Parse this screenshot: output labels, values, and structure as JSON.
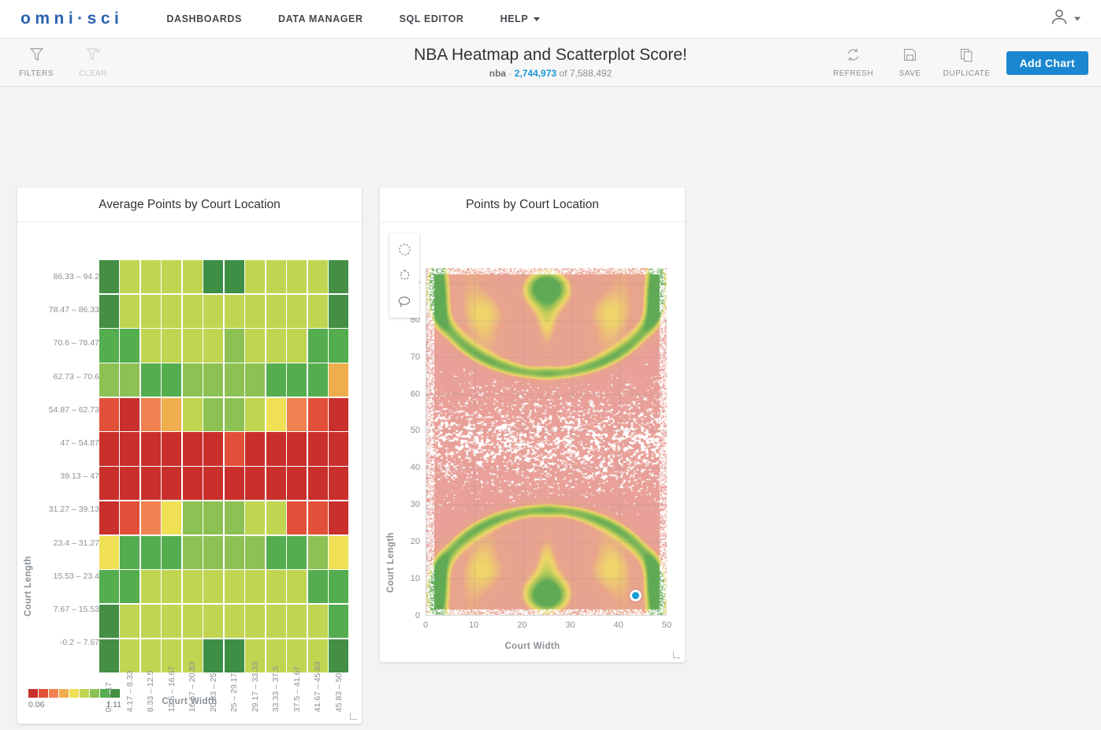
{
  "nav": {
    "brand": "omni·sci",
    "links": [
      {
        "label": "DASHBOARDS",
        "caret": false
      },
      {
        "label": "DATA MANAGER",
        "caret": false
      },
      {
        "label": "SQL EDITOR",
        "caret": false
      },
      {
        "label": "HELP",
        "caret": true
      }
    ],
    "user_icon": "user-avatar-icon"
  },
  "toolbar": {
    "filters_label": "FILTERS",
    "clear_label": "CLEAR",
    "refresh_label": "REFRESH",
    "save_label": "SAVE",
    "duplicate_label": "DUPLICATE",
    "add_chart_label": "Add Chart",
    "title": "NBA Heatmap and Scatterplot Score!",
    "subtitle_db": "nba",
    "subtitle_sep": "·",
    "subtitle_count": "2,744,973",
    "subtitle_of": "of 7,588,492",
    "accent_color": "#1a87d0",
    "count_color": "#1a9ad6"
  },
  "charts": {
    "heatmap": {
      "title": "Average Points by Court Location",
      "xlabel": "Court Width",
      "ylabel": "Court Length",
      "legend_min": "0.06",
      "legend_max": "1.11",
      "legend_colors": [
        "#c9302c",
        "#e2503a",
        "#ef8250",
        "#eeae4d",
        "#efe055",
        "#c1d552",
        "#8dc154",
        "#54ad4f",
        "#458f45"
      ]
    },
    "scatter": {
      "title": "Points by Court Location",
      "xlabel": "Court Width",
      "ylabel": "Court Length",
      "tools": [
        "circle-select-icon",
        "polygon-select-icon",
        "lasso-select-icon"
      ],
      "cursor": {
        "x": 43.5,
        "y": 5.6
      }
    }
  },
  "chart_data": [
    {
      "type": "heatmap",
      "title": "Average Points by Court Location",
      "xlabel": "Court Width",
      "ylabel": "Court Length",
      "legend": {
        "min": 0.06,
        "max": 1.11,
        "steps": 9
      },
      "x_categories": [
        "0 – 4.17",
        "4.17 – 8.33",
        "8.33 – 12.5",
        "12.5 – 16.67",
        "16.67 – 20.83",
        "20.83 – 25",
        "25 – 29.17",
        "29.17 – 33.33",
        "33.33 – 37.5",
        "37.5 – 41.67",
        "41.67 – 45.83",
        "45.83 – 50"
      ],
      "y_categories": [
        "86.33 – 94.2",
        "78.47 – 86.33",
        "70.6 – 78.47",
        "62.73 – 70.6",
        "54.87 – 62.73",
        "47 – 54.87",
        "39.13 – 47",
        "31.27 – 39.13",
        "23.4 – 31.27",
        "15.53 – 23.4",
        "7.67 – 15.53",
        "-0.2 – 7.67"
      ],
      "cell_colors": [
        [
          "#458f45",
          "#c1d552",
          "#c1d552",
          "#c1d552",
          "#c1d552",
          "#3e8e46",
          "#3e8e46",
          "#c1d552",
          "#c1d552",
          "#c1d552",
          "#c1d552",
          "#458f45"
        ],
        [
          "#458f45",
          "#c1d552",
          "#c1d552",
          "#c1d552",
          "#c1d552",
          "#c1d552",
          "#c1d552",
          "#c1d552",
          "#c1d552",
          "#c1d552",
          "#c1d552",
          "#458f45"
        ],
        [
          "#54ad4f",
          "#54ad4f",
          "#c1d552",
          "#c1d552",
          "#c1d552",
          "#c1d552",
          "#8dc154",
          "#c1d552",
          "#c1d552",
          "#c1d552",
          "#54ad4f",
          "#54ad4f"
        ],
        [
          "#8dc154",
          "#8dc154",
          "#54ad4f",
          "#54ad4f",
          "#8dc154",
          "#8dc154",
          "#8dc154",
          "#8dc154",
          "#54ad4f",
          "#54ad4f",
          "#54ad4f",
          "#eeae4d"
        ],
        [
          "#e2503a",
          "#c9302c",
          "#ef8250",
          "#eeae4d",
          "#c1d552",
          "#8dc154",
          "#8dc154",
          "#c1d552",
          "#efe055",
          "#ef8250",
          "#e2503a",
          "#c9302c"
        ],
        [
          "#c9302c",
          "#c9302c",
          "#c9302c",
          "#c9302c",
          "#c9302c",
          "#c9302c",
          "#e2503a",
          "#c9302c",
          "#c9302c",
          "#c9302c",
          "#c9302c",
          "#c9302c"
        ],
        [
          "#c9302c",
          "#c9302c",
          "#c9302c",
          "#c9302c",
          "#c9302c",
          "#c9302c",
          "#c9302c",
          "#c9302c",
          "#c9302c",
          "#c9302c",
          "#c9302c",
          "#c9302c"
        ],
        [
          "#c9302c",
          "#e2503a",
          "#ef8250",
          "#efe055",
          "#8dc154",
          "#8dc154",
          "#8dc154",
          "#c1d552",
          "#c1d552",
          "#e2503a",
          "#e2503a",
          "#c9302c"
        ],
        [
          "#efe055",
          "#54ad4f",
          "#54ad4f",
          "#54ad4f",
          "#8dc154",
          "#8dc154",
          "#8dc154",
          "#8dc154",
          "#54ad4f",
          "#54ad4f",
          "#8dc154",
          "#efe055"
        ],
        [
          "#54ad4f",
          "#54ad4f",
          "#c1d552",
          "#c1d552",
          "#c1d552",
          "#c1d552",
          "#c1d552",
          "#c1d552",
          "#c1d552",
          "#c1d552",
          "#54ad4f",
          "#54ad4f"
        ],
        [
          "#458f45",
          "#c1d552",
          "#c1d552",
          "#c1d552",
          "#c1d552",
          "#c1d552",
          "#c1d552",
          "#c1d552",
          "#c1d552",
          "#c1d552",
          "#c1d552",
          "#54ad4f"
        ],
        [
          "#458f45",
          "#c1d552",
          "#c1d552",
          "#c1d552",
          "#c1d552",
          "#3e8e46",
          "#3e8e46",
          "#c1d552",
          "#c1d552",
          "#c1d552",
          "#c1d552",
          "#458f45"
        ]
      ]
    },
    {
      "type": "scatter",
      "title": "Points by Court Location",
      "xlabel": "Court Width",
      "ylabel": "Court Length",
      "xlim": [
        0,
        50
      ],
      "ylim": [
        0,
        94
      ],
      "xticks": [
        0,
        10,
        20,
        30,
        40,
        50
      ],
      "yticks": [
        0,
        10,
        20,
        30,
        40,
        50,
        60,
        70,
        80,
        90
      ],
      "grid": true,
      "density_colors": [
        "#e8a09a",
        "#efdc6e",
        "#8dc154",
        "#5aa košt"
      ]
    }
  ]
}
